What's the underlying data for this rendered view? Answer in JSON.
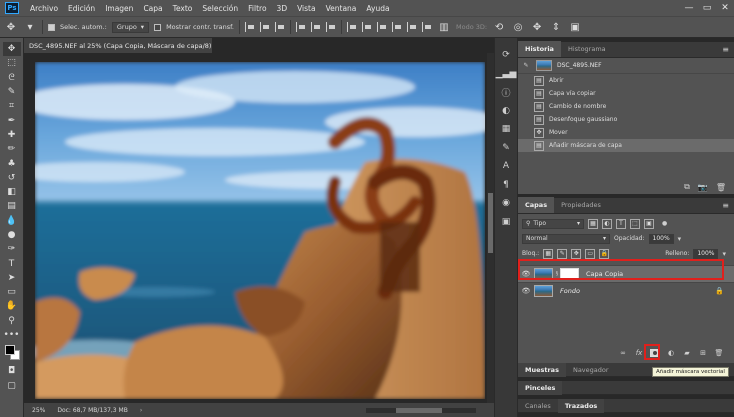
{
  "app": {
    "logo": "Ps"
  },
  "menu": [
    "Archivo",
    "Edición",
    "Imagen",
    "Capa",
    "Texto",
    "Selección",
    "Filtro",
    "3D",
    "Vista",
    "Ventana",
    "Ayuda"
  ],
  "window_controls": {
    "minimize": "—",
    "maximize": "▭",
    "close": "✕"
  },
  "options_bar": {
    "auto_select_label": "Selec. autom.:",
    "auto_select_value": "Grupo",
    "show_transform_label": "Mostrar contr. transf.",
    "mode_3d": "Modo 3D:"
  },
  "document": {
    "tab_title": "DSC_4895.NEF al 25% (Capa Copia, Máscara de capa/8) *",
    "close": "×"
  },
  "status": {
    "zoom": "25%",
    "doc": "Doc: 68,7 MB/137,3 MB",
    "arrow": "›"
  },
  "history_panel": {
    "tabs": [
      "Historia",
      "Histograma"
    ],
    "menu": "≡",
    "snapshot": "DSC_4895.NEF",
    "items": [
      {
        "label": "Abrir",
        "selected": false
      },
      {
        "label": "Capa vía copiar",
        "selected": false
      },
      {
        "label": "Cambio de nombre",
        "selected": false
      },
      {
        "label": "Desenfoque gaussiano",
        "selected": false
      },
      {
        "label": "Mover",
        "selected": false
      },
      {
        "label": "Añadir máscara de capa",
        "selected": true
      }
    ]
  },
  "layers_panel": {
    "tabs": [
      "Capas",
      "Propiedades"
    ],
    "menu": "≡",
    "filter_label": "Tipo",
    "blend_mode": "Normal",
    "opacity_label": "Opacidad:",
    "opacity_value": "100%",
    "lock_label": "Bloq.:",
    "fill_label": "Relleno:",
    "fill_value": "100%",
    "layers": [
      {
        "name": "Capa Copia",
        "selected": true,
        "has_mask": true
      },
      {
        "name": "Fondo",
        "selected": false,
        "has_mask": false,
        "locked": true
      }
    ],
    "footer_fx": "fx",
    "tooltip": "Añadir máscara vectorial"
  },
  "collapsed_panels": {
    "row1": [
      "Muestras",
      "Navegador"
    ],
    "row2": [
      "Pinceles"
    ],
    "row3": [
      "Canales",
      "Trazados"
    ]
  }
}
